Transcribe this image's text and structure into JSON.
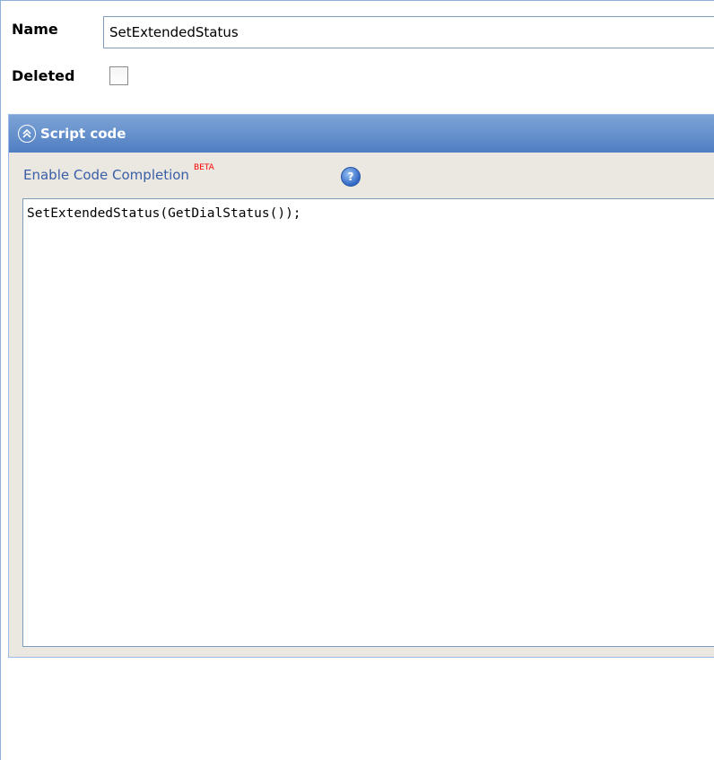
{
  "form": {
    "name_label": "Name",
    "name_value": "SetExtendedStatus",
    "deleted_label": "Deleted",
    "deleted_checked": false
  },
  "panel": {
    "title": "Script code",
    "collapse_icon": "double-chevron-up-icon",
    "completion_link": "Enable Code Completion",
    "beta_badge": "BETA",
    "help_icon": "help-question-icon",
    "code": "SetExtendedStatus(GetDialStatus());"
  },
  "colors": {
    "header_gradient_top": "#7ea4d6",
    "header_gradient_bottom": "#4f7ec2",
    "panel_body": "#eae8e0",
    "link": "#3a5ea8",
    "beta": "#ff0000"
  }
}
